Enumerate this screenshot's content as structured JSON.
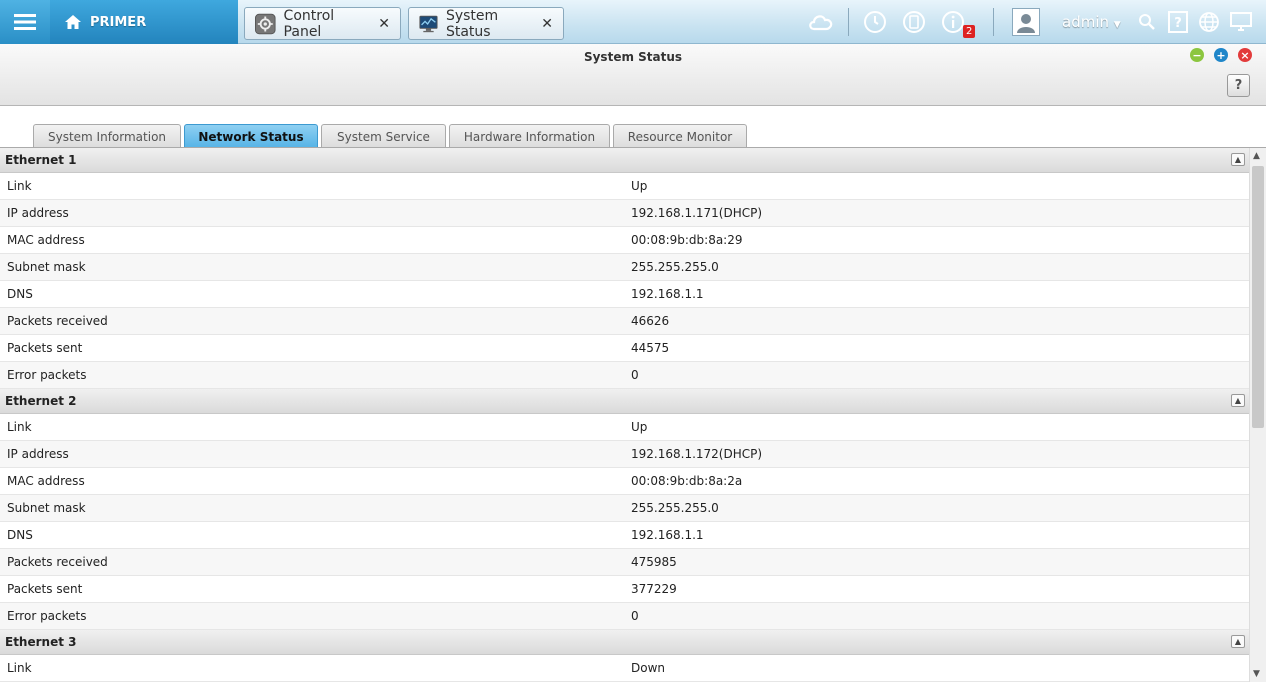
{
  "topbar": {
    "home_label": "PRIMER",
    "apps": [
      {
        "label": "Control Panel"
      },
      {
        "label": "System Status"
      }
    ],
    "notification_count": "2",
    "user": "admin",
    "icons": [
      "cloud-icon",
      "clock-icon",
      "sync-icon",
      "info-icon",
      "user-avatar-icon",
      "search-icon",
      "help-icon",
      "globe-icon",
      "monitor-icon"
    ]
  },
  "window": {
    "title": "System Status",
    "help_label": "?"
  },
  "tabs": [
    {
      "label": "System Information"
    },
    {
      "label": "Network Status"
    },
    {
      "label": "System Service"
    },
    {
      "label": "Hardware Information"
    },
    {
      "label": "Resource Monitor"
    }
  ],
  "active_tab": "Network Status",
  "sections": [
    {
      "title": "Ethernet 1",
      "rows": [
        {
          "k": "Link",
          "v": "Up"
        },
        {
          "k": "IP address",
          "v": "192.168.1.171(DHCP)"
        },
        {
          "k": "MAC address",
          "v": "00:08:9b:db:8a:29"
        },
        {
          "k": "Subnet mask",
          "v": "255.255.255.0"
        },
        {
          "k": "DNS",
          "v": "192.168.1.1"
        },
        {
          "k": "Packets received",
          "v": "46626"
        },
        {
          "k": "Packets sent",
          "v": "44575"
        },
        {
          "k": "Error packets",
          "v": "0"
        }
      ]
    },
    {
      "title": "Ethernet 2",
      "rows": [
        {
          "k": "Link",
          "v": "Up"
        },
        {
          "k": "IP address",
          "v": "192.168.1.172(DHCP)"
        },
        {
          "k": "MAC address",
          "v": "00:08:9b:db:8a:2a"
        },
        {
          "k": "Subnet mask",
          "v": "255.255.255.0"
        },
        {
          "k": "DNS",
          "v": "192.168.1.1"
        },
        {
          "k": "Packets received",
          "v": "475985"
        },
        {
          "k": "Packets sent",
          "v": "377229"
        },
        {
          "k": "Error packets",
          "v": "0"
        }
      ]
    },
    {
      "title": "Ethernet 3",
      "rows": [
        {
          "k": "Link",
          "v": "Down"
        }
      ]
    }
  ],
  "colors": {
    "accent": "#2a8fc6",
    "active_tab": "#55b3e6",
    "minimize": "#8cc63f",
    "maximize": "#1f86c9",
    "close": "#e23b3b"
  }
}
